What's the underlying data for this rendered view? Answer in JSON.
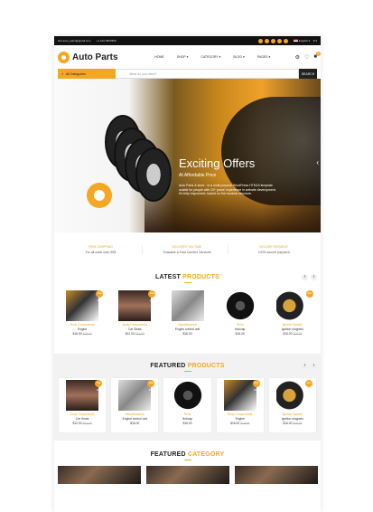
{
  "topbar": {
    "email": "info.auto_parts@gmail.com",
    "phone": "+1 123-4567890",
    "language": "English",
    "currency": "$"
  },
  "header": {
    "logo_text": "Auto Parts",
    "nav": [
      "HOME",
      "SHOP",
      "CATEGORY",
      "BLOG",
      "PAGES"
    ],
    "cart_count": "0"
  },
  "search": {
    "category_label": "All Categories",
    "placeholder": "What do you need?",
    "button_label": "SEARCH"
  },
  "hero": {
    "title": "Exciting Offers",
    "subtitle": "At Affordable Price",
    "text": "Auto Parts & store - is a multi purpose WordPress HTML5 template usable for people with 10+ years' experience in website development. It's fully responsive, based on the modular structure."
  },
  "features": [
    {
      "title": "FREE SHIPPING",
      "text": "For all order over 99$"
    },
    {
      "title": "DELIVERY ON TIME",
      "text": "Trustable & Fast Carriers Services"
    },
    {
      "title": "SECURE PAYMENT",
      "text": "100% secure payment"
    }
  ],
  "latest": {
    "title_plain": "LATEST ",
    "title_accent": "PRODUCTS",
    "items": [
      {
        "category": "Body Components",
        "name": "Engine",
        "price": "$16.00",
        "old": "$18.00",
        "sale": "Sale 20%"
      },
      {
        "category": "Body Components",
        "name": "Car Seats",
        "price": "$12.00",
        "old": "$14.00",
        "sale": "Sale 20%"
      },
      {
        "category": "Miscellaneous",
        "name": "Engine control unit",
        "price": "$16.00",
        "old": "",
        "sale": ""
      },
      {
        "category": "Rims",
        "name": "Hubcap",
        "price": "$16.00",
        "old": "",
        "sale": ""
      },
      {
        "category": "Ignition System",
        "name": "Ignition magneto",
        "price": "$16.00",
        "old": "$18.00",
        "sale": "Sale 20%"
      }
    ]
  },
  "featured": {
    "title_plain": "FEATURED ",
    "title_accent": "PRODUCTS",
    "items": [
      {
        "category": "Body Components",
        "name": "Car Seats",
        "price": "$12.00",
        "old": "$14.00",
        "sale": "Sale 20%"
      },
      {
        "category": "Miscellaneous",
        "name": "Engine control unit",
        "price": "$16.00",
        "old": "",
        "sale": "Sale 20%"
      },
      {
        "category": "Rims",
        "name": "Hubcap",
        "price": "$16.00",
        "old": "",
        "sale": ""
      },
      {
        "category": "Body Components",
        "name": "Engine",
        "price": "$16.00",
        "old": "$18.00",
        "sale": "Sale 20%"
      },
      {
        "category": "Ignition System",
        "name": "Ignition magneto",
        "price": "$16.00",
        "old": "$18.00",
        "sale": "Sale 20%"
      }
    ]
  },
  "featured_category": {
    "title_plain": "FEATURED ",
    "title_accent": "CATEGORY"
  },
  "colors": {
    "accent": "#f5a623",
    "dark": "#111111"
  }
}
